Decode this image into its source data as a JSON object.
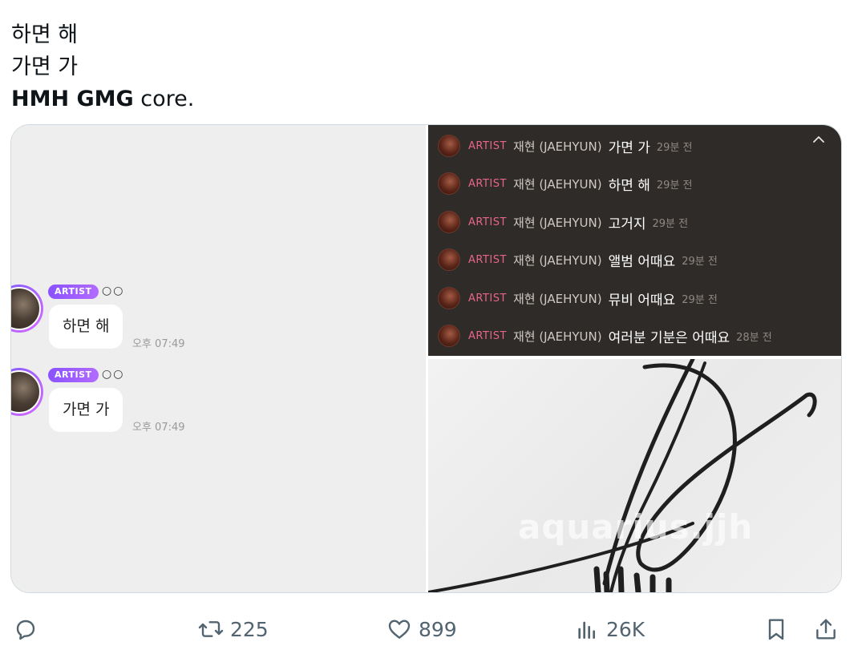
{
  "tweet": {
    "lines": [
      "하면 해",
      "가면 가"
    ],
    "last_bold": "HMH GMG",
    "last_rest": " core."
  },
  "left_chat": {
    "messages": [
      {
        "badge": "ARTIST",
        "dots": "○○",
        "text": "하면 해",
        "time": "오후 07:49"
      },
      {
        "badge": "ARTIST",
        "dots": "○○",
        "text": "가면 가",
        "time": "오후 07:49"
      }
    ]
  },
  "right_chat": {
    "rows": [
      {
        "badge": "ARTIST",
        "name": "재현 (JAEHYUN)",
        "msg": "가면 가",
        "time": "29분 전"
      },
      {
        "badge": "ARTIST",
        "name": "재현 (JAEHYUN)",
        "msg": "하면 해",
        "time": "29분 전"
      },
      {
        "badge": "ARTIST",
        "name": "재현 (JAEHYUN)",
        "msg": "고거지",
        "time": "29분 전"
      },
      {
        "badge": "ARTIST",
        "name": "재현 (JAEHYUN)",
        "msg": "앨범 어때요",
        "time": "29분 전"
      },
      {
        "badge": "ARTIST",
        "name": "재현 (JAEHYUN)",
        "msg": "뮤비 어때요",
        "time": "29분 전"
      },
      {
        "badge": "ARTIST",
        "name": "재현 (JAEHYUN)",
        "msg": "여러분 기분은 어때요",
        "time": "28분 전"
      }
    ]
  },
  "signature": {
    "watermark": "aquarius.jjh"
  },
  "actions": {
    "reply": {
      "icon": "reply-icon"
    },
    "retweet": {
      "icon": "retweet-icon",
      "count": "225"
    },
    "like": {
      "icon": "heart-icon",
      "count": "899"
    },
    "views": {
      "icon": "views-icon",
      "count": "26K"
    },
    "bookmark": {
      "icon": "bookmark-icon"
    },
    "share": {
      "icon": "share-icon"
    }
  }
}
